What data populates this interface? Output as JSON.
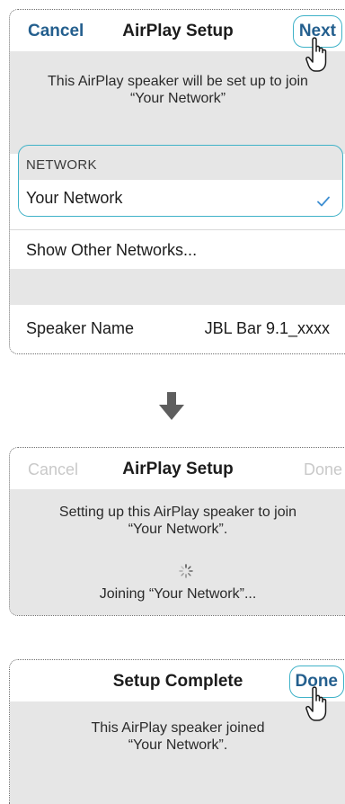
{
  "panel1": {
    "cancel": "Cancel",
    "title": "AirPlay Setup",
    "next": "Next",
    "message_line1": "This AirPlay speaker will be set up to join",
    "message_line2": "“Your Network”",
    "section_header": "NETWORK",
    "selected_network": "Your Network",
    "other_networks": "Show Other Networks...",
    "speaker_name_label": "Speaker Name",
    "speaker_name_value": "JBL Bar 9.1_xxxx"
  },
  "panel2": {
    "cancel": "Cancel",
    "title": "AirPlay Setup",
    "done": "Done",
    "message_line1": "Setting up this AirPlay speaker to join",
    "message_line2": "“Your Network”.",
    "status": "Joining “Your Network”..."
  },
  "panel3": {
    "title": "Setup Complete",
    "done": "Done",
    "message_line1": "This AirPlay speaker joined",
    "message_line2": "“Your Network”."
  },
  "colors": {
    "accent_blue": "#245f8e",
    "highlight_outline": "#3fb2c8",
    "disabled_text": "#c9c9c9",
    "panel_gray": "#e6e6e6"
  },
  "icons": [
    "checkmark-icon",
    "down-arrow-icon",
    "spinner-icon",
    "pointing-hand-icon"
  ]
}
